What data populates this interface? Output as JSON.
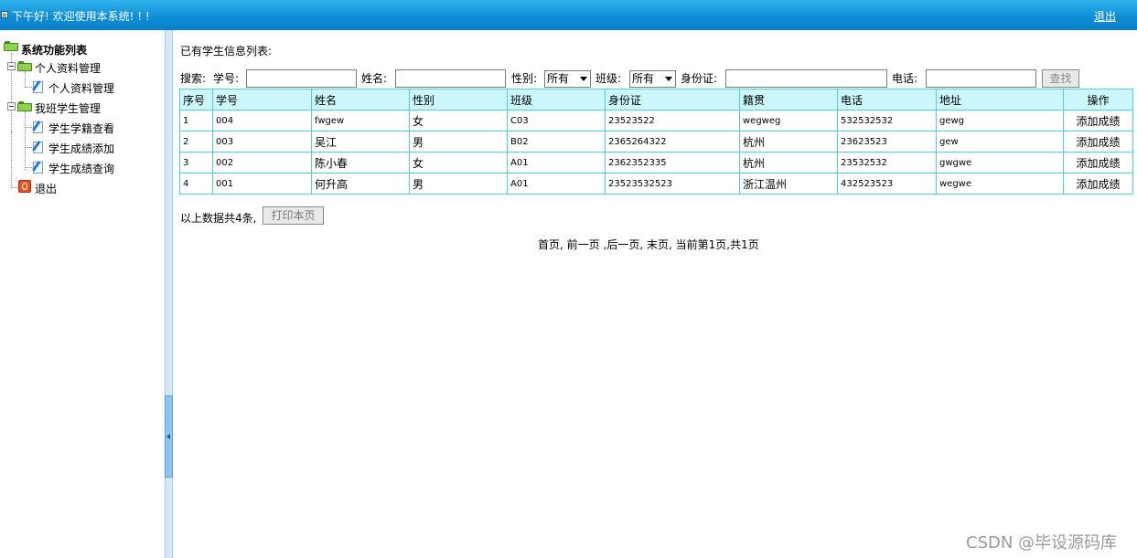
{
  "header": {
    "greeting": "下午好! 欢迎使用本系统! ! !",
    "logout": "退出",
    "gradient_top": "#33b4ee",
    "gradient_bottom": "#0a7fc8"
  },
  "sidebar": {
    "root": "系统功能列表",
    "groups": [
      {
        "label": "个人资料管理",
        "items": [
          "个人资料管理"
        ]
      },
      {
        "label": "我班学生管理",
        "items": [
          "学生学籍查看",
          "学生成绩添加",
          "学生成绩查询"
        ]
      }
    ],
    "exit": "退出"
  },
  "main": {
    "title": "已有学生信息列表:",
    "search": {
      "prefix": "搜索:",
      "student_id_label": "学号:",
      "name_label": "姓名:",
      "gender_label": "性别:",
      "gender_value": "所有",
      "class_label": "班级:",
      "class_value": "所有",
      "id_card_label": "身份证:",
      "phone_label": "电话:",
      "find_button": "查找"
    },
    "table": {
      "headers": [
        "序号",
        "学号",
        "姓名",
        "性别",
        "班级",
        "身份证",
        "籍贯",
        "电话",
        "地址",
        "操作"
      ],
      "rows": [
        [
          "1",
          "004",
          "fwgew",
          "女",
          "C03",
          "23523522",
          "wegweg",
          "532532532",
          "gewg",
          "添加成绩"
        ],
        [
          "2",
          "003",
          "吴江",
          "男",
          "B02",
          "2365264322",
          "杭州",
          "23623523",
          "gew",
          "添加成绩"
        ],
        [
          "3",
          "002",
          "陈小春",
          "女",
          "A01",
          "2362352335",
          "杭州",
          "23532532",
          "gwgwe",
          "添加成绩"
        ],
        [
          "4",
          "001",
          "何升高",
          "男",
          "A01",
          "23523532523",
          "浙江温州",
          "432523523",
          "wegwe",
          "添加成绩"
        ]
      ],
      "border_color": "#4fd0d8",
      "header_bg": "#ccf7fc"
    },
    "count_text": "以上数据共4条,",
    "print_button": "打印本页",
    "pager": {
      "first": "首页,",
      "prev": "前一页",
      "next": ",后一页,",
      "last": "末页,",
      "status": "当前第1页,共1页"
    }
  },
  "watermark": "CSDN @毕设源码库"
}
